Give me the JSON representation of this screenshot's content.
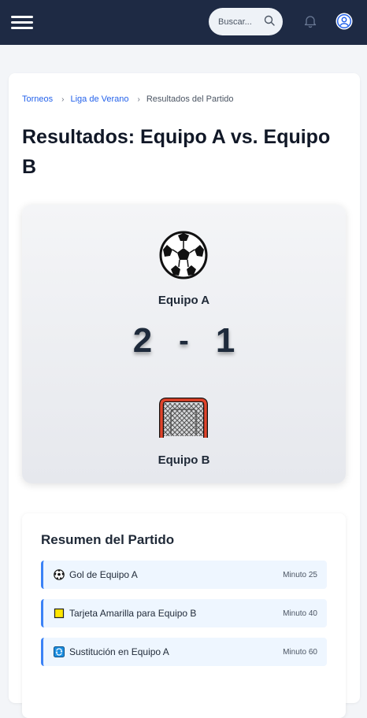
{
  "search": {
    "placeholder": "Buscar..."
  },
  "breadcrumb": {
    "items": [
      "Torneos",
      "Liga de Verano"
    ],
    "current": "Resultados del Partido",
    "separator": "›"
  },
  "page": {
    "title": "Resultados: Equipo A vs. Equipo B"
  },
  "match": {
    "team_a": {
      "name": "Equipo A",
      "icon": "soccer-ball-icon",
      "score": "2"
    },
    "team_b": {
      "name": "Equipo B",
      "icon": "goal-net-icon",
      "score": "1"
    },
    "separator": "-"
  },
  "summary": {
    "title": "Resumen del Partido",
    "events": [
      {
        "icon": "soccer-ball-icon",
        "text": "Gol de Equipo A",
        "minute": "Minuto 25"
      },
      {
        "icon": "yellow-card-icon",
        "text": "Tarjeta Amarilla para Equipo B",
        "minute": "Minuto 40"
      },
      {
        "icon": "substitution-icon",
        "text": "Sustitución en Equipo A",
        "minute": "Minuto 60"
      }
    ]
  },
  "colors": {
    "header_bg": "#1e2a44",
    "link": "#2563eb",
    "event_accent": "#3b82f6",
    "event_bg": "#eef6ff"
  }
}
